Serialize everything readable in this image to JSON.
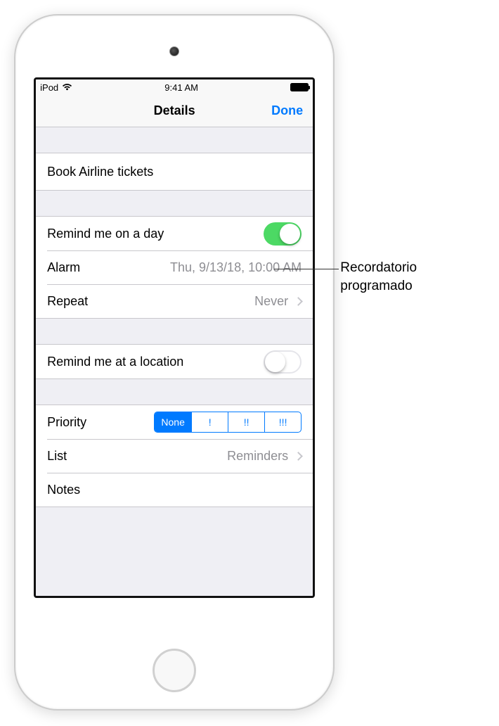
{
  "status_bar": {
    "device": "iPod",
    "time": "9:41 AM"
  },
  "nav": {
    "title": "Details",
    "done": "Done"
  },
  "reminder": {
    "title": "Book Airline tickets"
  },
  "day_section": {
    "remind_day_label": "Remind me on a day",
    "remind_day_on": true,
    "alarm_label": "Alarm",
    "alarm_value": "Thu, 9/13/18, 10:00 AM",
    "repeat_label": "Repeat",
    "repeat_value": "Never"
  },
  "location_section": {
    "remind_location_label": "Remind me at a location",
    "remind_location_on": false
  },
  "meta_section": {
    "priority_label": "Priority",
    "priority_options": [
      "None",
      "!",
      "!!",
      "!!!"
    ],
    "priority_selected_index": 0,
    "list_label": "List",
    "list_value": "Reminders",
    "notes_label": "Notes"
  },
  "callout_text": "Recordatorio programado"
}
